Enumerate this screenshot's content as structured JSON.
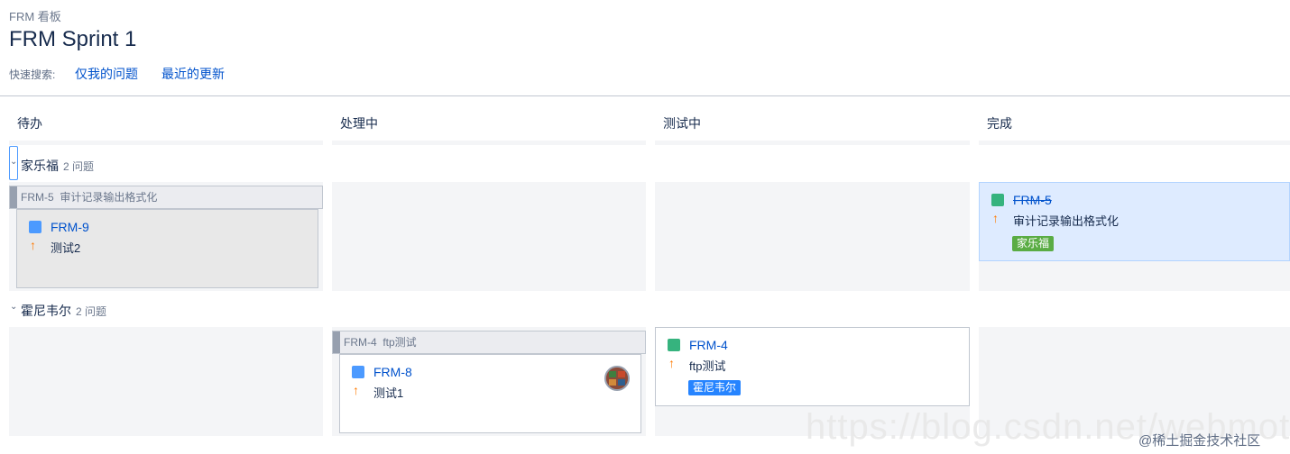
{
  "header": {
    "breadcrumb": "FRM 看板",
    "title": "FRM Sprint 1",
    "quick_search_label": "快速搜索:",
    "quick_filters": [
      "仅我的问题",
      "最近的更新"
    ]
  },
  "columns": [
    "待办",
    "处理中",
    "测试中",
    "完成"
  ],
  "swimlanes": [
    {
      "name": "家乐福",
      "count": "2 问题",
      "parent": {
        "key": "FRM-5",
        "summary": "审计记录输出格式化"
      },
      "todo_card": {
        "key": "FRM-9",
        "summary": "测试2"
      },
      "done_card": {
        "key": "FRM-5",
        "summary": "审计记录输出格式化",
        "label": "家乐福"
      }
    },
    {
      "name": "霍尼韦尔",
      "count": "2 问题",
      "parent": {
        "key": "FRM-4",
        "summary": "ftp测试"
      },
      "progress_card": {
        "key": "FRM-8",
        "summary": "测试1"
      },
      "testing_card": {
        "key": "FRM-4",
        "summary": "ftp测试",
        "label": "霍尼韦尔"
      }
    }
  ],
  "watermark": "https://blog.csdn.net/webmote",
  "credit": "@稀土掘金技术社区",
  "colors": {
    "link": "#0052cc",
    "label_green": "#5aac44",
    "label_blue": "#2684ff",
    "priority_high": "#ff7a00",
    "done_card_bg": "#deebff"
  },
  "icons": [
    "subtask-icon",
    "story-icon",
    "priority-high-icon",
    "chevron-down-icon"
  ]
}
